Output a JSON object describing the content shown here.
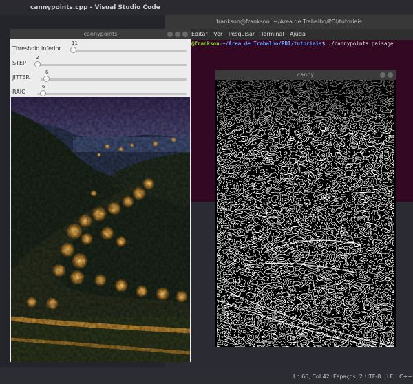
{
  "vscode": {
    "title": "cannypoints.cpp - Visual Studio Code",
    "status": {
      "position": "Ln 66, Col 42",
      "spaces": "Espaços: 2",
      "encoding": "UTF-8",
      "eol": "LF",
      "language": "C++"
    }
  },
  "terminal": {
    "title": "frankson@frankson: ~/Área de Trabalho/PDI/tutoriais",
    "menu": [
      "Editar",
      "Ver",
      "Pesquisar",
      "Terminal",
      "Ajuda"
    ],
    "prompt_user": "@frankson",
    "prompt_path": ":~/Área de Trabalho/PDI/tutoriais",
    "command": "$ ./cannypoints paisage"
  },
  "cannypoints_window": {
    "title": "cannypoints",
    "trackbars": [
      {
        "label": "Threshold inferior",
        "value": "11",
        "level": 0.04
      },
      {
        "label": "STEP",
        "value": "2",
        "level": 0.0
      },
      {
        "label": "JITTER",
        "value": "6",
        "level": 0.02
      },
      {
        "label": "RAIO",
        "value": "6",
        "level": 0.02
      }
    ]
  },
  "canny_window": {
    "title": "canny"
  },
  "colors": {
    "terminal_bg": "#330822",
    "editor_bg": "#24242b",
    "prompt_user": "#7ed321",
    "prompt_path": "#6aa5ff"
  }
}
